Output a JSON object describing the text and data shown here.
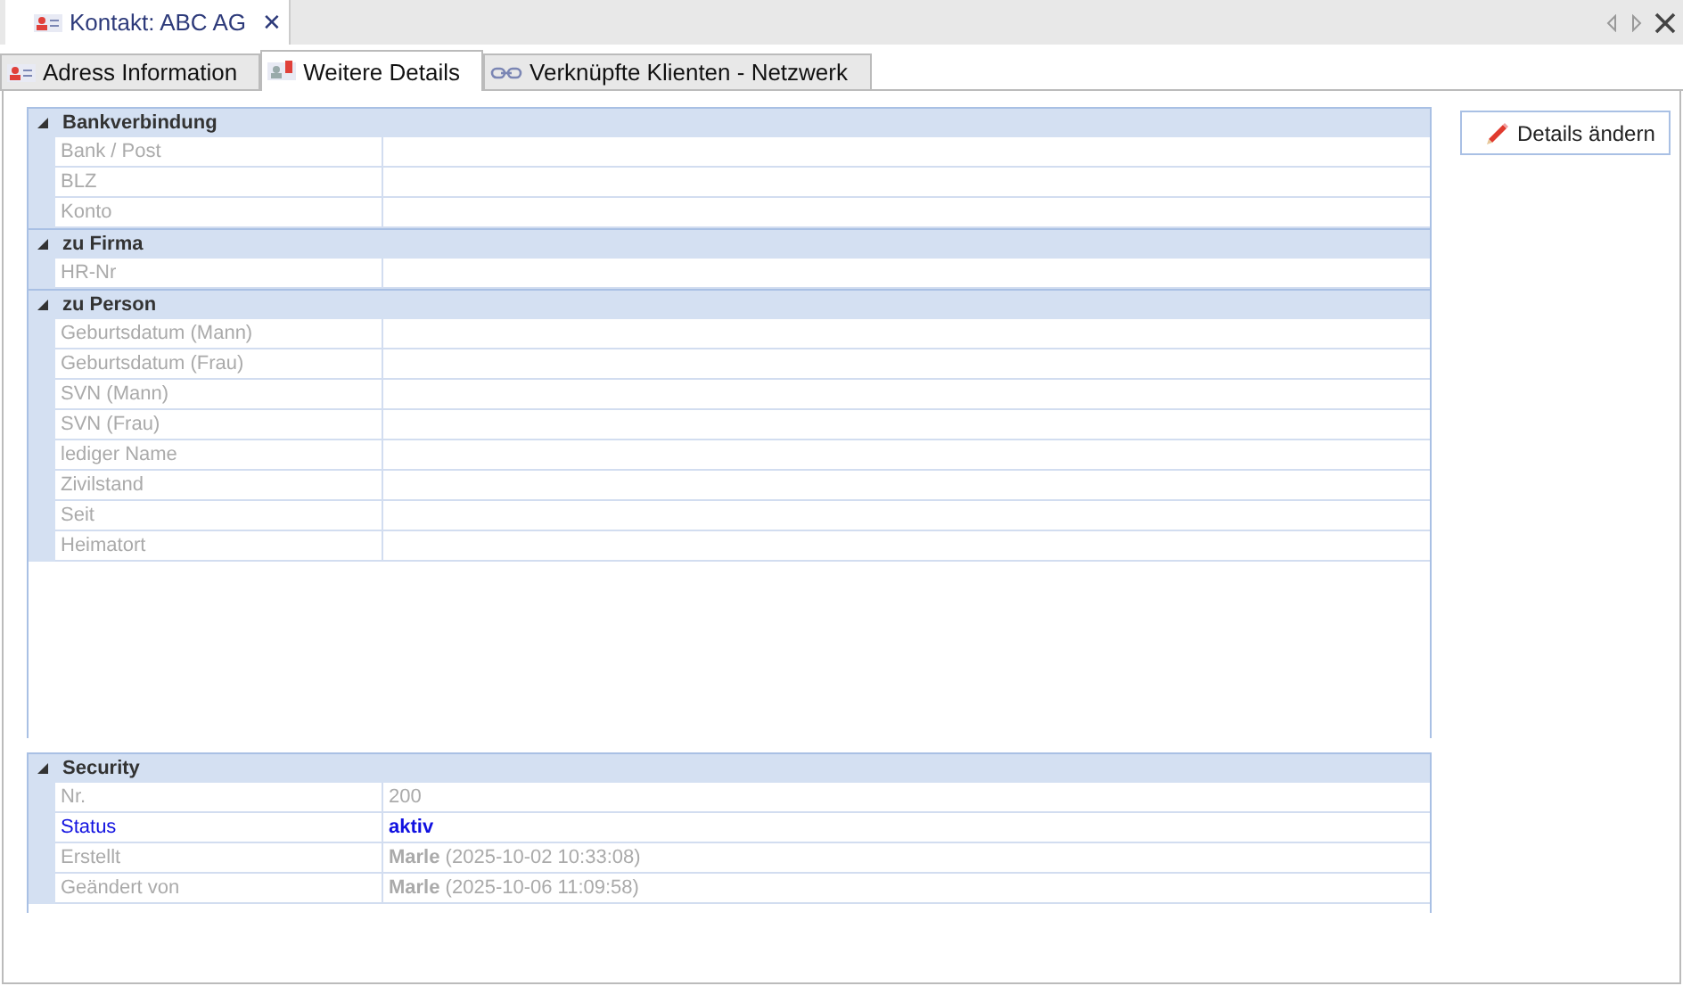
{
  "document_tab": {
    "title": "Kontakt: ABC AG",
    "close": "✕"
  },
  "tabs": [
    {
      "label": "Adress Information",
      "kind": "contact",
      "selected": false
    },
    {
      "label": "Weitere Details",
      "kind": "details",
      "selected": true
    },
    {
      "label": "Verknüpfte Klienten -  Netzwerk",
      "kind": "link",
      "selected": false
    }
  ],
  "details_grid": {
    "groups": [
      {
        "title": "Bankverbindung",
        "expanded": true,
        "rows": [
          {
            "label": "Bank / Post"
          },
          {
            "label": "BLZ"
          },
          {
            "label": "Konto"
          }
        ]
      },
      {
        "title": "zu Firma",
        "expanded": true,
        "rows": [
          {
            "label": "HR-Nr"
          }
        ]
      },
      {
        "title": "zu Person",
        "expanded": true,
        "rows": [
          {
            "label": "Geburtsdatum (Mann)"
          },
          {
            "label": "Geburtsdatum (Frau)"
          },
          {
            "label": "SVN (Mann)"
          },
          {
            "label": "SVN (Frau)"
          },
          {
            "label": "lediger Name"
          },
          {
            "label": "Zivilstand"
          },
          {
            "label": "Seit"
          },
          {
            "label": "Heimatort"
          }
        ]
      }
    ]
  },
  "security_grid": {
    "groups": [
      {
        "title": "Security",
        "expanded": true,
        "rows": [
          {
            "label": "Nr.",
            "value": "200",
            "emphasized": false
          },
          {
            "label": "Status",
            "value": "aktiv",
            "emphasized": true
          },
          {
            "label": "Erstellt",
            "value": "**Marle** (2025-10-02 10:33:08)",
            "emphasized": false
          },
          {
            "label": "Geändert von",
            "value": "**Marle** (2025-10-06 11:09:58)",
            "emphasized": false
          }
        ]
      }
    ]
  },
  "edit_button": {
    "label": "Details ändern"
  }
}
